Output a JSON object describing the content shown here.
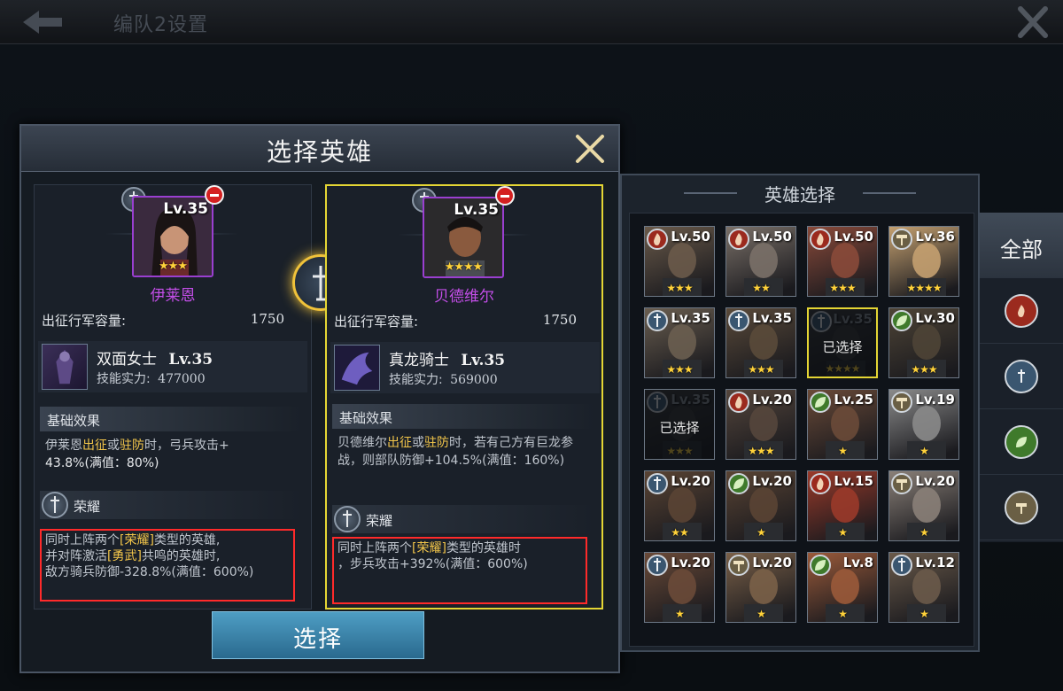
{
  "topbar": {
    "title": "编队2设置"
  },
  "dialog": {
    "title": "选择英雄",
    "select_button": "选择",
    "heroes": [
      {
        "name": "伊莱恩",
        "level": "Lv.35",
        "stars": "★★★",
        "capacity_label": "出征行军容量:",
        "capacity_value": "1750",
        "skill_name": "双面女士",
        "skill_level": "Lv.35",
        "skill_power_label": "技能实力:",
        "skill_power_value": "477000",
        "base_effect_label": "基础效果",
        "base_effect_parts": [
          "伊莱恩",
          "出征",
          "或",
          "驻防",
          "时，弓兵攻击+",
          "43.8%(满值：80%)"
        ],
        "honor_label": "荣耀",
        "honor_line1": "同时上阵两个",
        "honor_tag": "[荣耀]",
        "honor_line1b": "类型的英雄,",
        "honor_line2a": "并对阵激活",
        "honor_tag2": "[勇武]",
        "honor_line2b": "共鸣的英雄时,",
        "honor_line3": "敌方骑兵防御-328.8%(满值：600%)"
      },
      {
        "name": "贝德维尔",
        "level": "Lv.35",
        "stars": "★★★★",
        "capacity_label": "出征行军容量:",
        "capacity_value": "1750",
        "skill_name": "真龙骑士",
        "skill_level": "Lv.35",
        "skill_power_label": "技能实力:",
        "skill_power_value": "569000",
        "base_effect_label": "基础效果",
        "base_effect_parts": [
          "贝德维尔",
          "出征",
          "或",
          "驻防",
          "时，若有己方有巨龙参战，则部队防御+104.5%(满值：160%)"
        ],
        "honor_label": "荣耀",
        "honor_line1": "同时上阵两个",
        "honor_tag": "[荣耀]",
        "honor_line1b": "类型的英雄时",
        "honor_line2": "，步兵攻击+392%(满值：600%)"
      }
    ]
  },
  "picker": {
    "title": "英雄选择",
    "selected_text": "已选择",
    "cards": [
      {
        "level": "Lv.50",
        "stars": "★★★",
        "faction": "fire",
        "selected": false
      },
      {
        "level": "Lv.50",
        "stars": "★★",
        "faction": "fire",
        "selected": false
      },
      {
        "level": "Lv.50",
        "stars": "★★★",
        "faction": "fire",
        "selected": false
      },
      {
        "level": "Lv.36",
        "stars": "★★★★",
        "faction": "hammer",
        "selected": false
      },
      {
        "level": "Lv.35",
        "stars": "★★★",
        "faction": "sword",
        "selected": false
      },
      {
        "level": "Lv.35",
        "stars": "★★★",
        "faction": "sword",
        "selected": false
      },
      {
        "level": "Lv.35",
        "stars": "★★★★",
        "faction": "sword",
        "selected": true,
        "highlight": true
      },
      {
        "level": "Lv.30",
        "stars": "★★★",
        "faction": "leaf",
        "selected": false
      },
      {
        "level": "Lv.35",
        "stars": "★★★",
        "faction": "sword",
        "selected": true
      },
      {
        "level": "Lv.20",
        "stars": "★★★",
        "faction": "fire",
        "selected": false
      },
      {
        "level": "Lv.25",
        "stars": "★",
        "faction": "leaf",
        "selected": false
      },
      {
        "level": "Lv.19",
        "stars": "★",
        "faction": "hammer",
        "selected": false
      },
      {
        "level": "Lv.20",
        "stars": "★★",
        "faction": "sword",
        "selected": false
      },
      {
        "level": "Lv.20",
        "stars": "★",
        "faction": "leaf",
        "selected": false
      },
      {
        "level": "Lv.15",
        "stars": "★",
        "faction": "fire",
        "selected": false
      },
      {
        "level": "Lv.20",
        "stars": "★",
        "faction": "hammer",
        "selected": false
      },
      {
        "level": "Lv.20",
        "stars": "★",
        "faction": "sword",
        "selected": false
      },
      {
        "level": "Lv.20",
        "stars": "★",
        "faction": "hammer",
        "selected": false
      },
      {
        "level": "Lv.8",
        "stars": "★",
        "faction": "leaf",
        "selected": false
      },
      {
        "level": "Lv.12",
        "stars": "★",
        "faction": "sword",
        "selected": false
      }
    ]
  },
  "filters": [
    {
      "label": "全部",
      "icon": "all",
      "active": true
    },
    {
      "label": "",
      "icon": "fire-icon",
      "active": false
    },
    {
      "label": "",
      "icon": "sword-icon",
      "active": false
    },
    {
      "label": "",
      "icon": "leaf-icon",
      "active": false
    },
    {
      "label": "",
      "icon": "hammer-icon",
      "active": false
    }
  ],
  "colors": {
    "fire": "#9b2a1e",
    "sword": "#3a5670",
    "leaf": "#3f7a2b",
    "hammer": "#6a5f45",
    "selected_border": "#e4d534",
    "highlight_text": "#f3c64a",
    "hero_name": "#c34ee8"
  }
}
